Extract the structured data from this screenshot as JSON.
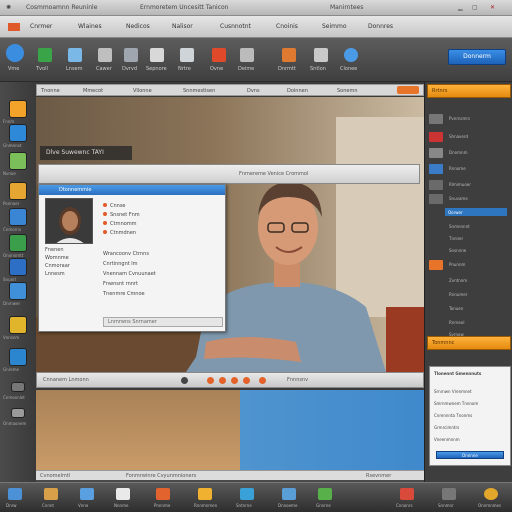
{
  "window": {
    "title_left": "Cosmmoamnn Reuninle",
    "title_mid": "Ernmoretem Uncesitt Tanicon",
    "title_right": "Manirntees"
  },
  "menu": [
    "Cnrmer",
    "Wlaines",
    "Nedicos",
    "Nalisor",
    "Cusnnotnt",
    "Cnoinis",
    "Seimmo",
    "Donnres"
  ],
  "toolbar": {
    "icons": [
      {
        "icon": "globe-icon",
        "color": "#3b8de0",
        "label": "Vme"
      },
      {
        "icon": "leaf-icon",
        "color": "#3aa548",
        "label": "Tvoll"
      },
      {
        "icon": "pen-icon",
        "color": "#7ab8e8",
        "label": "Lnsem"
      },
      {
        "icon": "frame-icon",
        "color": "#bfbfbf",
        "label": "Cawer"
      },
      {
        "icon": "film-icon",
        "color": "#9fa6b0",
        "label": "Dvrvd"
      },
      {
        "icon": "book-icon",
        "color": "#d8d8d8",
        "label": "Sepnore"
      },
      {
        "icon": "tile-icon",
        "color": "#cfd4d8",
        "label": "Nrtre"
      },
      {
        "icon": "photo-red-icon",
        "color": "#e04a2a",
        "label": "Ovne"
      },
      {
        "icon": "grid-icon",
        "color": "#bbbbbb",
        "label": "Deime"
      },
      {
        "icon": "picture-icon",
        "color": "#e07a30",
        "label": "Dnrmtt"
      },
      {
        "icon": "camera-icon",
        "color": "#c9c9c9",
        "label": "Sntlon"
      },
      {
        "icon": "globe-blue-icon",
        "color": "#4a9ae6",
        "label": "Clonee"
      }
    ],
    "action_button": "Donnerm"
  },
  "path_bar": {
    "segments": [
      "Tnonne",
      "Mmecot",
      "Vllonne",
      "Snnmestisen",
      "Dvns",
      "Doinnen",
      "Sonemn"
    ]
  },
  "video": {
    "caption": "Dlve Suwewnc TAYI",
    "header_text": "Fnmereme Venice Crommol"
  },
  "dialog": {
    "title": "Dtonnemmie",
    "lines": [
      "Fnenen",
      "Womnme",
      "Cnmoraar",
      "Lnnesm"
    ],
    "chat_items": [
      "Cnnse",
      "Snsnet Fnm",
      "Ctrnnomm",
      "Ctnmdnen",
      "Wrancoonv Ctrnns",
      "Cnrtinngnt lm",
      "Vnennam Cvnuunaet",
      "Fnwnsnt rnnrt",
      "Tnenmre Cmnoe"
    ],
    "footer": "Lnmrwns Snrnamer"
  },
  "transport": {
    "left_text": "Cnnanem Lnmonn",
    "right_text": "Fnnnsnv"
  },
  "status": {
    "left": "Cvnomelmtl",
    "mid": "Fonmrwinre Cvyunmnioners",
    "right": "Rsevnmer"
  },
  "right_panel": {
    "header": "Rrtnrs",
    "rows": [
      "Pvnrnsmrs",
      "Shnaverd",
      "Dnnmnm",
      "Rnnome",
      "Rlmimuoer",
      "Snuvame",
      "Oorwer",
      "Snmnnnnt",
      "Tnnner",
      "Snsnnrw",
      "Pnunnm",
      "Zvntnnm",
      "Rnnumer",
      "Tonuen",
      "Rnrneol",
      "Syrnow"
    ],
    "section_header": "Tonmnnc",
    "card_title": "Tlonennt Gmennnuts",
    "card_lines": [
      "Srnrnwn Vrenmnet",
      "Smrnmwnem Tnnnom",
      "Cnrennnta Tnonms",
      "Grmrcimntrs",
      "Vneenmnnm"
    ],
    "card_button": "Dnnnne"
  },
  "sidebar": {
    "items": [
      {
        "icon": "folder-orange-icon",
        "color": "#f3a22a",
        "label": "Fnnm"
      },
      {
        "icon": "doc-blue-icon",
        "color": "#2e8ad8",
        "label": "Gnmenot"
      },
      {
        "icon": "image-icon",
        "color": "#7bbf5a",
        "label": "Nvnoe"
      },
      {
        "icon": "folder-icon",
        "color": "#e6a632",
        "label": "Ponnaer"
      },
      {
        "icon": "stack-icon",
        "color": "#3a86d4",
        "label": "Cnmornv"
      },
      {
        "icon": "tree-icon",
        "color": "#3a9e4a",
        "label": "Onnnnmtt"
      },
      {
        "icon": "book-blue-icon",
        "color": "#2d6fc4",
        "label": "Snunrl"
      },
      {
        "icon": "monitor-icon",
        "color": "#3f8fd9",
        "label": "Dnrnwer"
      },
      {
        "icon": "note-icon",
        "color": "#e0b52c",
        "label": "Vnnsnm"
      },
      {
        "icon": "cloud-icon",
        "color": "#2c86cf",
        "label": "Gnreme"
      },
      {
        "icon": "settings-icon",
        "color": "#777777",
        "label": "Cnmeonlet"
      },
      {
        "icon": "gear-icon",
        "color": "#9a9a9a",
        "label": "Onmaonem"
      }
    ]
  },
  "taskbar": {
    "items": [
      {
        "icon": "screen-icon",
        "color": "#4c91d6",
        "label": "Dnrw"
      },
      {
        "icon": "folder-task-icon",
        "color": "#d9a04a",
        "label": "Cnnnt"
      },
      {
        "icon": "window-icon",
        "color": "#5aa0e0",
        "label": "Vnne"
      },
      {
        "icon": "page-icon",
        "color": "#e9e9e9",
        "label": "Nnnme"
      },
      {
        "icon": "photo-task-icon",
        "color": "#e3632f",
        "label": "Pnnnme"
      },
      {
        "icon": "star-icon",
        "color": "#f0b030",
        "label": "Rnnmnmen"
      },
      {
        "icon": "cube-icon",
        "color": "#3aa0d8",
        "label": "Sntnrne"
      },
      {
        "icon": "monitor-task-icon",
        "color": "#5a9ed8",
        "label": "Dnnoeme"
      },
      {
        "icon": "people-icon",
        "color": "#58b04a",
        "label": "Gnnrne"
      },
      {
        "icon": "chart-icon",
        "color": "#d94a3a",
        "label": "Cnnonrs"
      },
      {
        "icon": "gear-task-icon",
        "color": "#777777",
        "label": "Snnmnr"
      },
      {
        "icon": "globe-task-icon",
        "color": "#e3a72c",
        "label": "Onnmnmes"
      }
    ]
  }
}
